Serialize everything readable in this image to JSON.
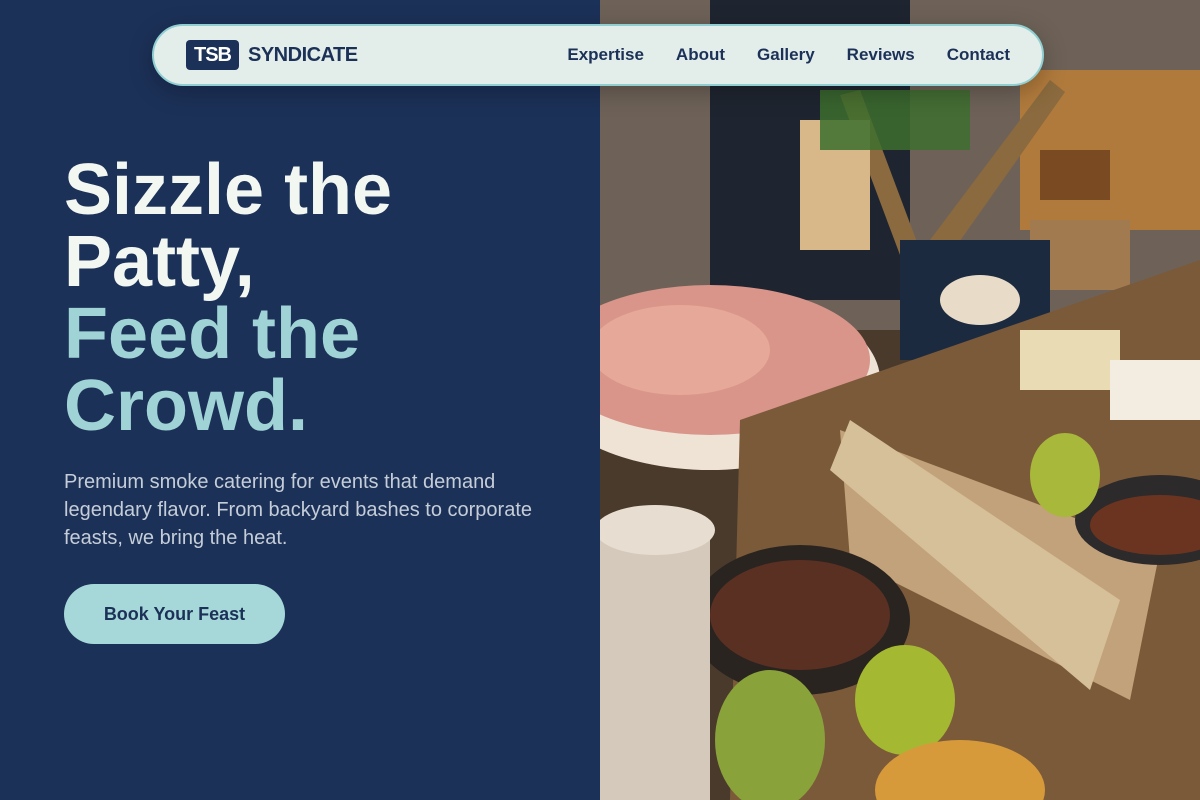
{
  "brand": {
    "logo_text": "TSB",
    "name": "SYNDICATE"
  },
  "nav": {
    "links": [
      "Expertise",
      "About",
      "Gallery",
      "Reviews",
      "Contact"
    ]
  },
  "hero": {
    "headline_line1": "Sizzle the",
    "headline_line2": "Patty,",
    "headline_line3": "Feed the",
    "headline_line4": "Crowd.",
    "subtitle": "Premium smoke catering for events that demand legendary flavor. From backyard bashes to corporate feasts, we bring the heat.",
    "cta_label": "Book Your Feast"
  },
  "image": {
    "subject": "catering-spread-photo"
  },
  "colors": {
    "background": "#1c3158",
    "accent": "#9fd3d6",
    "nav_background": "#e3eeea",
    "cta_background": "#a6d8d9"
  }
}
